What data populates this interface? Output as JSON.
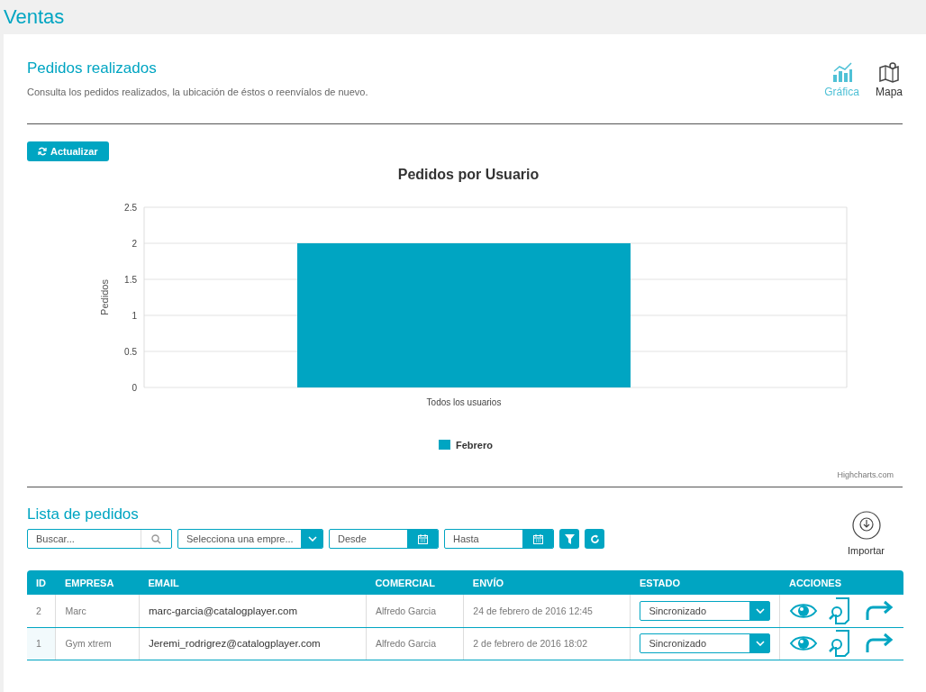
{
  "page_title": "Ventas",
  "section": {
    "title": "Pedidos realizados",
    "description": "Consulta los pedidos realizados, la ubicación de éstos o reenvíalos de nuevo."
  },
  "view_tabs": [
    {
      "label": "Gráfica",
      "kind": "chart",
      "selected": true
    },
    {
      "label": "Mapa",
      "kind": "map",
      "selected": false
    }
  ],
  "refresh_button": "Actualizar",
  "chart": {
    "credit": "Highcharts.com",
    "chart_data": {
      "type": "bar",
      "title": "Pedidos por Usuario",
      "ylabel": "Pedidos",
      "categories": [
        "Todos los usuarios"
      ],
      "series": [
        {
          "name": "Febrero",
          "color": "#00a5c2",
          "values": [
            2
          ]
        }
      ],
      "ylim": [
        0,
        2.5
      ],
      "grid": true,
      "yticks": [
        0,
        0.5,
        1,
        1.5,
        2,
        2.5
      ]
    }
  },
  "list": {
    "title": "Lista de pedidos",
    "search": {
      "placeholder": "Buscar..."
    },
    "company_select": {
      "value": "Selecciona una empre..."
    },
    "date_from": {
      "placeholder": "Desde"
    },
    "date_to": {
      "placeholder": "Hasta"
    },
    "import_label": "Importar"
  },
  "table": {
    "columns": [
      "ID",
      "EMPRESA",
      "EMAIL",
      "COMERCIAL",
      "ENVÍO",
      "ESTADO",
      "ACCIONES"
    ],
    "rows": [
      {
        "order_no": "2",
        "company": "Marc",
        "email": "marc-garcia@catalogplayer.com",
        "sales_rep": "Alfredo Garcia",
        "sent": "24 de febrero de 2016 12:45",
        "status": "Sincronizado"
      },
      {
        "order_no": "1",
        "company": "Gym xtrem",
        "email": "Jeremi_rodrigrez@catalogplayer.com",
        "sales_rep": "Alfredo Garcia",
        "sent": "2 de febrero de 2016 18:02",
        "status": "Sincronizado"
      }
    ]
  }
}
